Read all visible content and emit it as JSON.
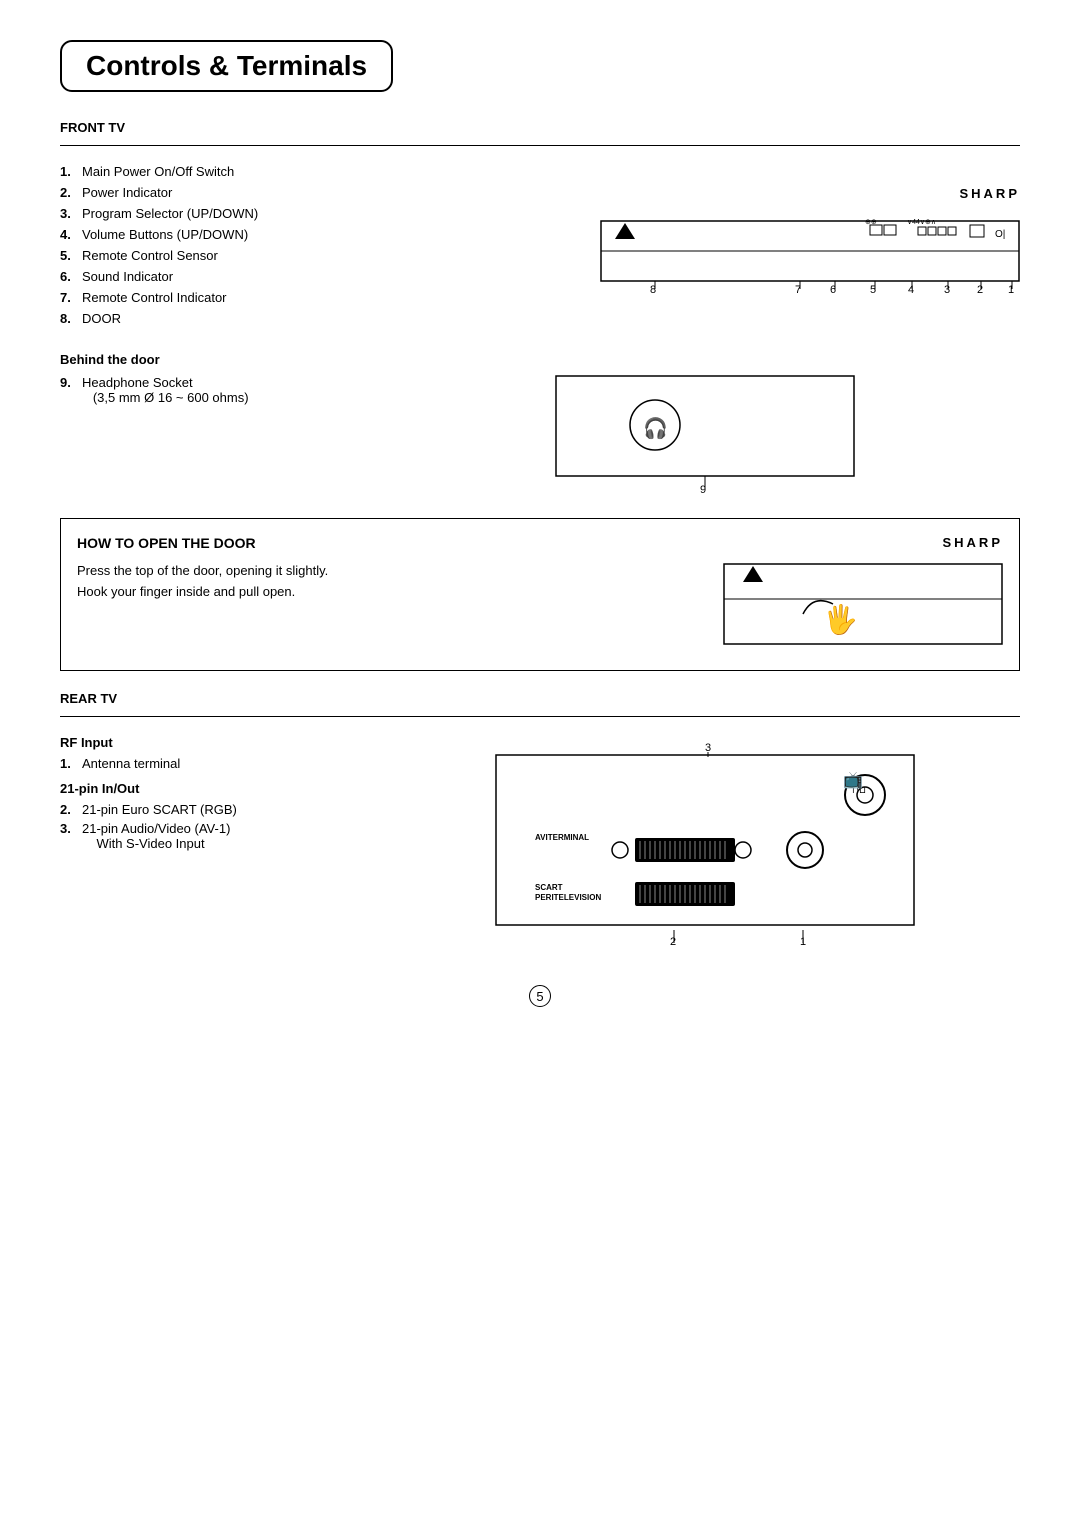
{
  "page": {
    "title": "Controls & Terminals",
    "page_number": "5"
  },
  "front_tv": {
    "header": "FRONT TV",
    "items": [
      {
        "num": "1.",
        "text": "Main Power On/Off Switch"
      },
      {
        "num": "2.",
        "text": "Power Indicator"
      },
      {
        "num": "3.",
        "text": "Program Selector (UP/DOWN)"
      },
      {
        "num": "4.",
        "text": "Volume Buttons (UP/DOWN)"
      },
      {
        "num": "5.",
        "text": "Remote Control Sensor"
      },
      {
        "num": "6.",
        "text": "Sound Indicator"
      },
      {
        "num": "7.",
        "text": "Remote Control Indicator"
      },
      {
        "num": "8.",
        "text": "DOOR"
      }
    ],
    "diagram_numbers": [
      "8",
      "7",
      "6",
      "5",
      "4",
      "3",
      "2",
      "1"
    ]
  },
  "behind_door": {
    "header": "Behind the door",
    "items": [
      {
        "num": "9.",
        "text": "Headphone Socket\n(3,5 mm Ø 16 ~ 600 ohms)"
      }
    ]
  },
  "how_to_open": {
    "title": "HOW TO OPEN THE DOOR",
    "text1": "Press the top of the door, opening it slightly.",
    "text2": "Hook your finger inside and pull open."
  },
  "rear_tv": {
    "header": "REAR TV",
    "rf_header": "RF Input",
    "rf_items": [
      {
        "num": "1.",
        "text": "Antenna terminal"
      }
    ],
    "pin_header": "21-pin In/Out",
    "pin_items": [
      {
        "num": "2.",
        "text": "21-pin Euro SCART (RGB)"
      },
      {
        "num": "3.",
        "text": "21-pin Audio/Video (AV-1)\n   With S-Video Input"
      }
    ],
    "labels": {
      "aviterminal": "AVITERMINAL",
      "scart": "SCART",
      "peritelevision": "PERITELEVISION"
    }
  },
  "sharp_logo": "SHARP"
}
